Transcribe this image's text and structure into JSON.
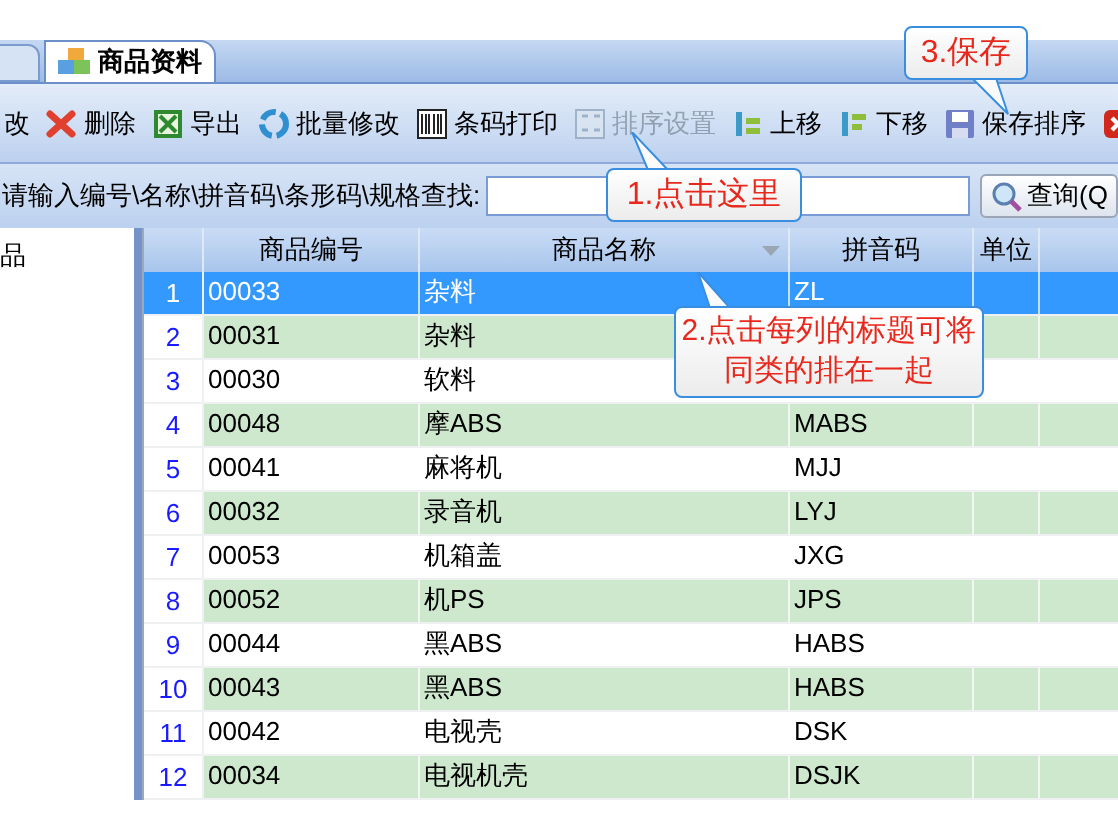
{
  "tabs": [
    {
      "label": "商品资料",
      "selected": true
    }
  ],
  "toolbar": [
    {
      "label": "改",
      "disabled": false
    },
    {
      "label": "删除",
      "disabled": false
    },
    {
      "label": "导出",
      "disabled": false
    },
    {
      "label": "批量修改",
      "disabled": false
    },
    {
      "label": "条码打印",
      "disabled": false
    },
    {
      "label": "排序设置",
      "disabled": true
    },
    {
      "label": "上移",
      "disabled": false
    },
    {
      "label": "下移",
      "disabled": false
    },
    {
      "label": "保存排序",
      "disabled": false
    },
    {
      "disabled": false
    }
  ],
  "search": {
    "label": "请输入编号\\名称\\拼音码\\条形码\\规格查找:",
    "button": "查询(Q"
  },
  "tree": {
    "items": [
      "品"
    ]
  },
  "table": {
    "columns": [
      "商品编号",
      "商品名称",
      "拼音码",
      "单位"
    ],
    "rows": [
      {
        "index": "1",
        "cells": [
          "00033",
          "杂料",
          "ZL",
          ""
        ],
        "selected": true
      },
      {
        "index": "2",
        "cells": [
          "00031",
          "杂料",
          "",
          ""
        ],
        "selected": false
      },
      {
        "index": "3",
        "cells": [
          "00030",
          "软料",
          "",
          ""
        ],
        "selected": false
      },
      {
        "index": "4",
        "cells": [
          "00048",
          "摩ABS",
          "MABS",
          ""
        ],
        "selected": false
      },
      {
        "index": "5",
        "cells": [
          "00041",
          "麻将机",
          "MJJ",
          ""
        ],
        "selected": false
      },
      {
        "index": "6",
        "cells": [
          "00032",
          "录音机",
          "LYJ",
          ""
        ],
        "selected": false
      },
      {
        "index": "7",
        "cells": [
          "00053",
          "机箱盖",
          "JXG",
          ""
        ],
        "selected": false
      },
      {
        "index": "8",
        "cells": [
          "00052",
          "机PS",
          "JPS",
          ""
        ],
        "selected": false
      },
      {
        "index": "9",
        "cells": [
          "00044",
          "黑ABS",
          "HABS",
          ""
        ],
        "selected": false
      },
      {
        "index": "10",
        "cells": [
          "00043",
          "黑ABS",
          "HABS",
          ""
        ],
        "selected": false
      },
      {
        "index": "11",
        "cells": [
          "00042",
          "电视壳",
          "DSK",
          ""
        ],
        "selected": false
      },
      {
        "index": "12",
        "cells": [
          "00034",
          "电视机壳",
          "DSJK",
          ""
        ],
        "selected": false
      }
    ]
  },
  "callouts": [
    {
      "text": "1.点击这里"
    },
    {
      "text": "2.点击每列的标题可将同类的排在一起"
    },
    {
      "text": "3.保存"
    }
  ]
}
